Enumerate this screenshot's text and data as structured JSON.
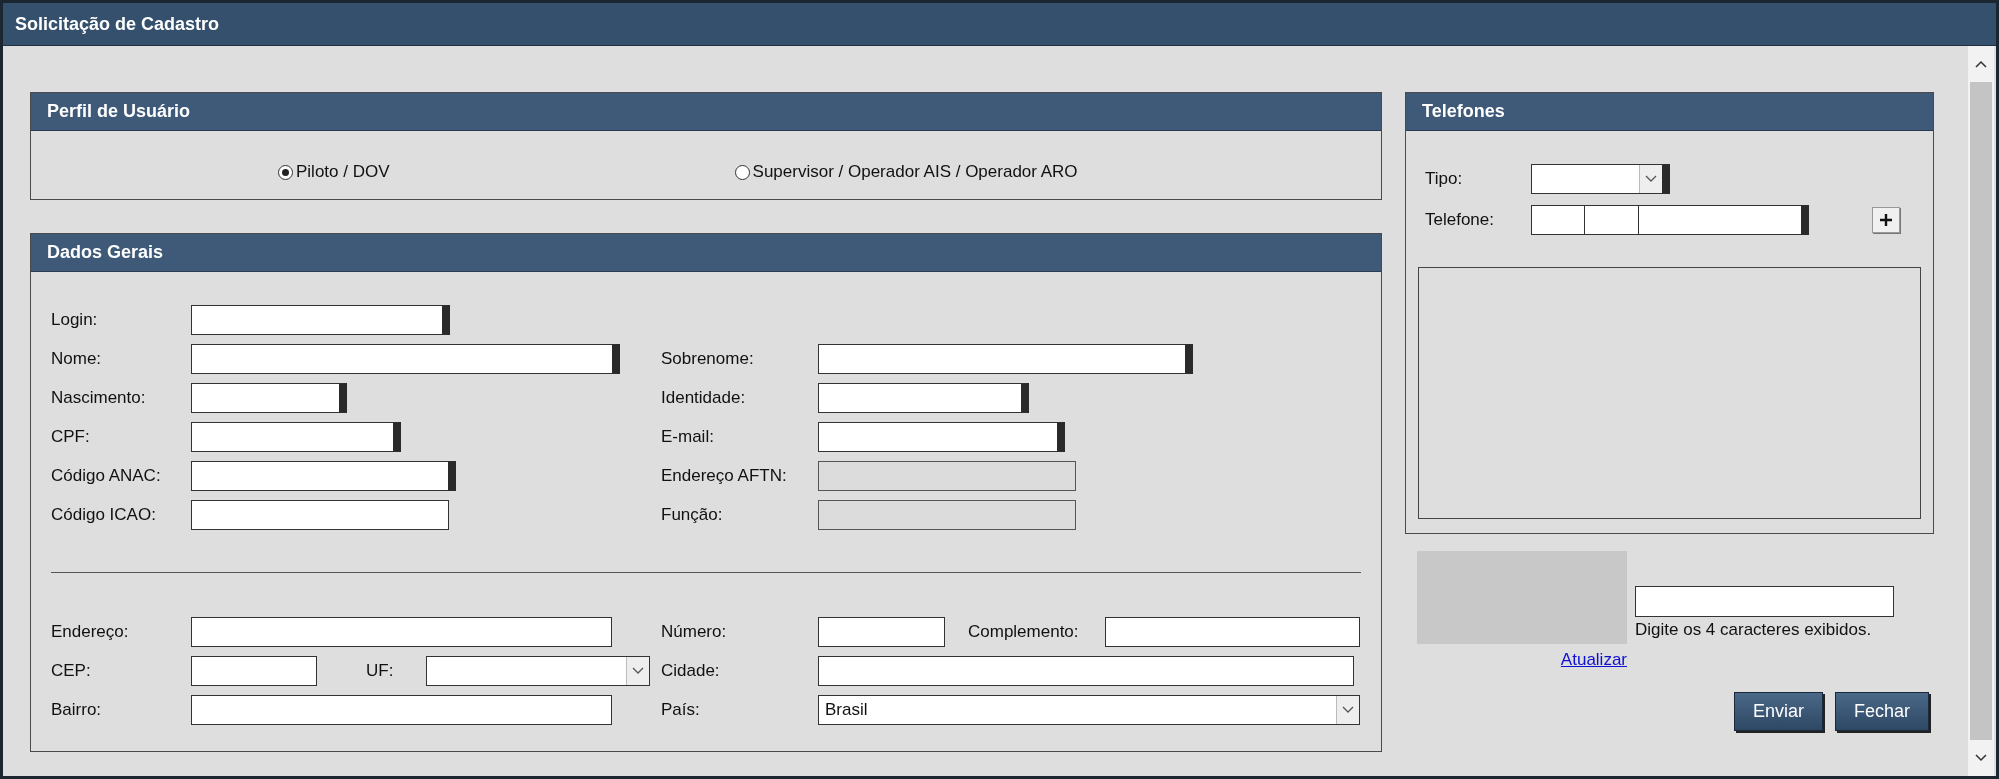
{
  "window": {
    "title": "Solicitação de Cadastro"
  },
  "perfil": {
    "title": "Perfil de Usuário",
    "options": [
      {
        "label": "Piloto / DOV",
        "selected": true
      },
      {
        "label": "Supervisor / Operador AIS / Operador ARO",
        "selected": false
      }
    ]
  },
  "dados_gerais": {
    "title": "Dados Gerais",
    "personal_rows": [
      {
        "left": {
          "label": "Login:",
          "required": true,
          "disabled": false
        }
      },
      {
        "left": {
          "label": "Nome:",
          "required": true,
          "disabled": false
        },
        "right": {
          "label": "Sobrenome:",
          "required": true,
          "disabled": false
        }
      },
      {
        "left": {
          "label": "Nascimento:",
          "required": true,
          "disabled": false
        },
        "right": {
          "label": "Identidade:",
          "required": true,
          "disabled": false
        }
      },
      {
        "left": {
          "label": "CPF:",
          "required": true,
          "disabled": false
        },
        "right": {
          "label": "E-mail:",
          "required": true,
          "disabled": false
        }
      },
      {
        "left": {
          "label": "Código ANAC:",
          "required": true,
          "disabled": false
        },
        "right": {
          "label": "Endereço AFTN:",
          "required": false,
          "disabled": true
        }
      },
      {
        "left": {
          "label": "Código ICAO:",
          "required": false,
          "disabled": false
        },
        "right": {
          "label": "Função:",
          "required": false,
          "disabled": true
        }
      }
    ],
    "address_rows": [
      {
        "left": [
          {
            "label": "Endereço:",
            "kind": "text"
          }
        ],
        "right": [
          {
            "label": "Número:",
            "kind": "text"
          },
          {
            "label": "Complemento:",
            "kind": "text"
          }
        ]
      },
      {
        "left": [
          {
            "label": "CEP:",
            "kind": "text"
          },
          {
            "label": "UF:",
            "kind": "select"
          }
        ],
        "right": [
          {
            "label": "Cidade:",
            "kind": "text"
          }
        ]
      },
      {
        "left": [
          {
            "label": "Bairro:",
            "kind": "text"
          }
        ],
        "right": [
          {
            "label": "País:",
            "kind": "select",
            "value": "Brasil"
          }
        ]
      }
    ]
  },
  "telefones": {
    "title": "Telefones",
    "tipo": {
      "label": "Tipo:",
      "required": true
    },
    "telefone": {
      "label": "Telefone:",
      "required": true
    }
  },
  "captcha": {
    "hint": "Digite os 4 caracteres exibidos.",
    "refresh_link": "Atualizar"
  },
  "buttons": [
    "Enviar",
    "Fechar"
  ]
}
